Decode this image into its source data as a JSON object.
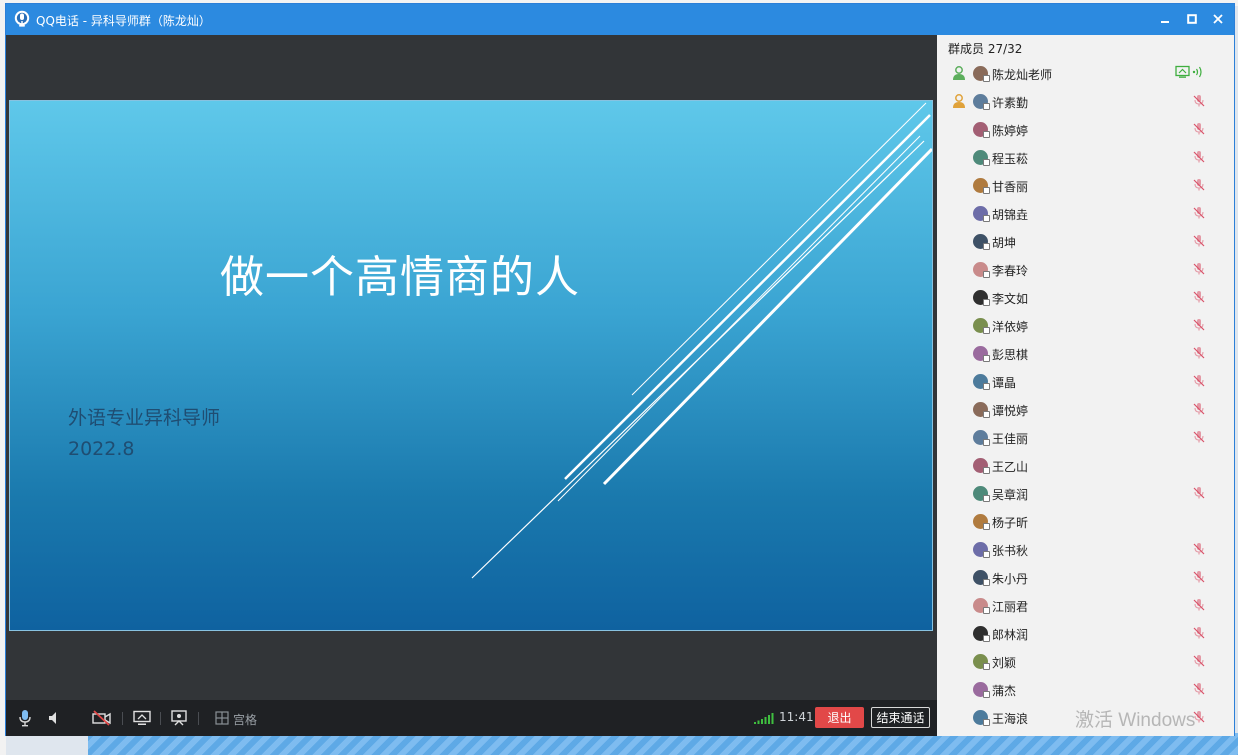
{
  "window": {
    "title": "QQ电话 - 异科导师群（陈龙灿）",
    "minimize_icon": "minimize-icon",
    "maximize_icon": "maximize-icon",
    "close_icon": "close-icon"
  },
  "slide": {
    "title": "做一个高情商的人",
    "subtitle": "外语专业异科导师",
    "date": "2022.8"
  },
  "toolbar": {
    "grid_label": "宫格",
    "time": "11:41",
    "exit_label": "退出",
    "end_call_label": "结束通话",
    "icons": [
      "microphone-icon",
      "speaker-icon",
      "camera-off-icon",
      "screen-share-icon",
      "whiteboard-icon",
      "grid-icon",
      "signal-icon"
    ]
  },
  "sidebar": {
    "header": "群成员 27/32",
    "members": [
      {
        "name": "陈龙灿老师",
        "role": "owner",
        "status": "speaking"
      },
      {
        "name": "许素勤",
        "role": "admin",
        "status": "muted"
      },
      {
        "name": "陈婷婷",
        "role": "",
        "status": "muted"
      },
      {
        "name": "程玉菘",
        "role": "",
        "status": "muted"
      },
      {
        "name": "甘香丽",
        "role": "",
        "status": "muted"
      },
      {
        "name": "胡锦垚",
        "role": "",
        "status": "muted"
      },
      {
        "name": "胡坤",
        "role": "",
        "status": "muted"
      },
      {
        "name": "李春玲",
        "role": "",
        "status": "muted"
      },
      {
        "name": "李文如",
        "role": "",
        "status": "muted"
      },
      {
        "name": "洋依婷",
        "role": "",
        "status": "muted"
      },
      {
        "name": "彭思棋",
        "role": "",
        "status": "muted"
      },
      {
        "name": "谭晶",
        "role": "",
        "status": "muted"
      },
      {
        "name": "谭悦婷",
        "role": "",
        "status": "muted"
      },
      {
        "name": "王佳丽",
        "role": "",
        "status": "muted"
      },
      {
        "name": "王乙山",
        "role": "",
        "status": ""
      },
      {
        "name": "吴章润",
        "role": "",
        "status": "muted"
      },
      {
        "name": "杨子昕",
        "role": "",
        "status": ""
      },
      {
        "name": "张书秋",
        "role": "",
        "status": "muted"
      },
      {
        "name": "朱小丹",
        "role": "",
        "status": "muted"
      },
      {
        "name": "江丽君",
        "role": "",
        "status": "muted"
      },
      {
        "name": "郎林润",
        "role": "",
        "status": "muted"
      },
      {
        "name": "刘颖",
        "role": "",
        "status": "muted"
      },
      {
        "name": "蒲杰",
        "role": "",
        "status": "muted"
      },
      {
        "name": "王海浪",
        "role": "",
        "status": "muted"
      }
    ]
  },
  "watermark": "激活 Windows",
  "colors": {
    "titlebar": "#2c8ae0",
    "exit_button": "#e24848",
    "mic_muted": "#e07a8a",
    "speaking": "#3fae3f"
  }
}
